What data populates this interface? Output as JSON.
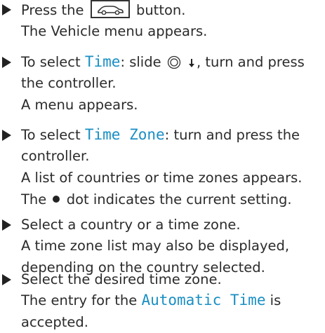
{
  "steps": [
    {
      "text_press": "Press the",
      "text_button": "button.",
      "result": "The Vehicle menu appears."
    },
    {
      "text_to_select": "To select",
      "highlight": "Time",
      "text_slide": ": slide",
      "text_turn": ", turn and press",
      "line2": "the controller.",
      "result": "A menu appears."
    },
    {
      "text_to_select": "To select",
      "highlight": "Time Zone",
      "text_rest": ": turn and press the",
      "line2": "controller.",
      "result1": "A list of countries or time zones appears.",
      "text_the": "The",
      "text_dot_rest": "dot indicates the current setting."
    },
    {
      "line1": "Select a country or a time zone.",
      "line2": "A time zone list may also be displayed,",
      "line3": "depending on the country selected."
    },
    {
      "line1": "Select the desired time zone.",
      "text_entry": "The entry for the",
      "highlight": "Automatic Time",
      "text_is": "is",
      "line3": "accepted."
    }
  ],
  "icons": [
    "bullet-arrow-icon",
    "vehicle-button-icon",
    "controller-icon",
    "down-arrow-icon",
    "current-setting-dot-icon"
  ]
}
